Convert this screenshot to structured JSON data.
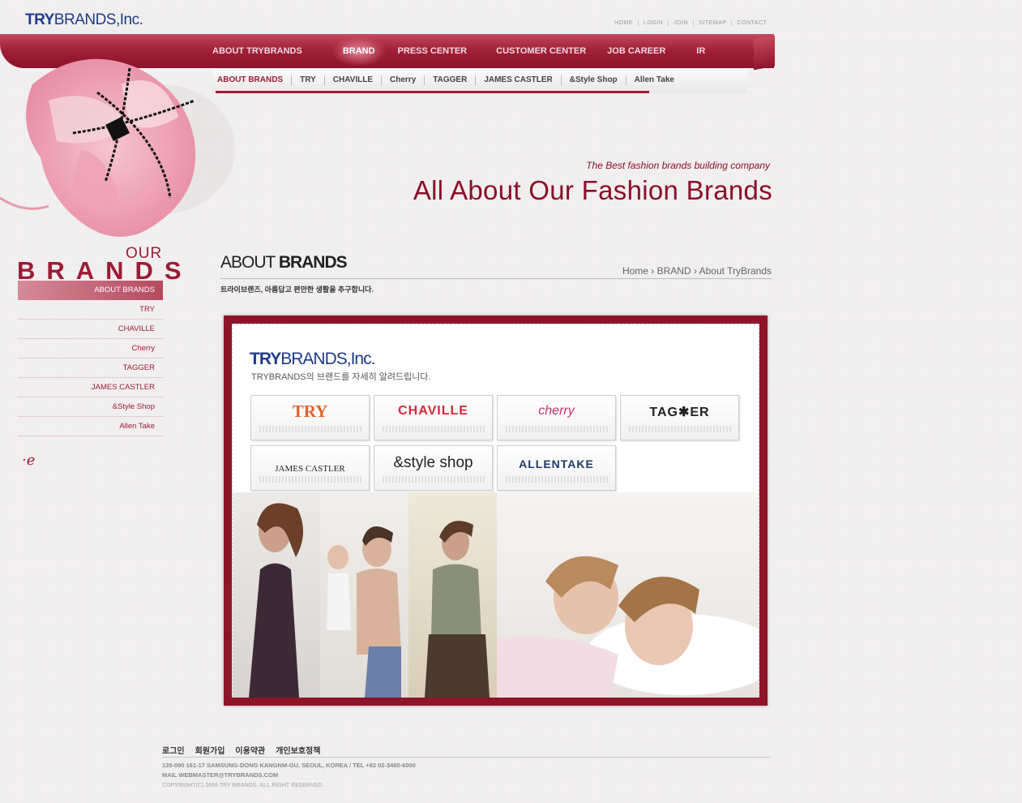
{
  "logo": {
    "bold": "TRY",
    "rest": "BRANDS,Inc."
  },
  "util_nav": [
    "HOME",
    "LOGIN",
    "JOIN",
    "SITEMAP",
    "CONTACT"
  ],
  "main_nav": [
    {
      "label": "ABOUT TRYBRANDS"
    },
    {
      "label": "BRAND"
    },
    {
      "label": "PRESS CENTER"
    },
    {
      "label": "CUSTOMER CENTER"
    },
    {
      "label": "JOB CAREER"
    },
    {
      "label": "IR"
    }
  ],
  "sub_nav": [
    "ABOUT BRANDS",
    "TRY",
    "CHAVILLE",
    "Cherry",
    "TAGGER",
    "JAMES CASTLER",
    "&Style Shop",
    "Allen Take"
  ],
  "hero": {
    "tagline": "The Best fashion brands building company",
    "headline": "All About Our Fashion Brands"
  },
  "sidebar": {
    "our": "OUR",
    "brands": "BRANDS",
    "items": [
      "ABOUT BRANDS",
      "TRY",
      "CHAVILLE",
      "Cherry",
      "TAGGER",
      "JAMES CASTLER",
      "&Style Shop",
      "Allen Take"
    ]
  },
  "section": {
    "title_light": "ABOUT",
    "title_bold": "BRANDS",
    "breadcrumb": "Home › BRAND › About TryBrands",
    "desc": "트라이브랜즈, 아름답고 편안한 생활을 추구합니다."
  },
  "panel": {
    "logo_bold": "TRY",
    "logo_rest": "BRANDS,Inc.",
    "sub": "TRYBRANDS의 브랜드를 자세히 알려드립니다.",
    "brands": [
      {
        "name": "TRY",
        "color": "#e3612a"
      },
      {
        "name": "CHAVILLE",
        "color": "#d8283a"
      },
      {
        "name": "cherry",
        "color": "#c8336e"
      },
      {
        "name": "TAG✱ER",
        "color": "#222222"
      },
      {
        "name": "JAMES CASTLER",
        "color": "#222222"
      },
      {
        "name": "&style shop",
        "color": "#222222"
      },
      {
        "name": "ALLENTAKE",
        "color": "#1d3b6a"
      }
    ]
  },
  "footer": {
    "links": [
      "로그인",
      "회원가입",
      "이용약관",
      "개인보호정책"
    ],
    "address": "135-090 161-17 SAMSUNG-DONG KANGNM-GU, SEOUL, KOREA  /  TEL +82 02-3485-6000",
    "mail": "MAIL WEBMASTER@TRYBRANDS.COM",
    "copyright": "COPYRIGHT(C) 2006 TRY BRANDS. ALL RIGHT RESERVED"
  },
  "colors": {
    "accent": "#8c0f26",
    "logo_blue": "#1d3b8a"
  }
}
